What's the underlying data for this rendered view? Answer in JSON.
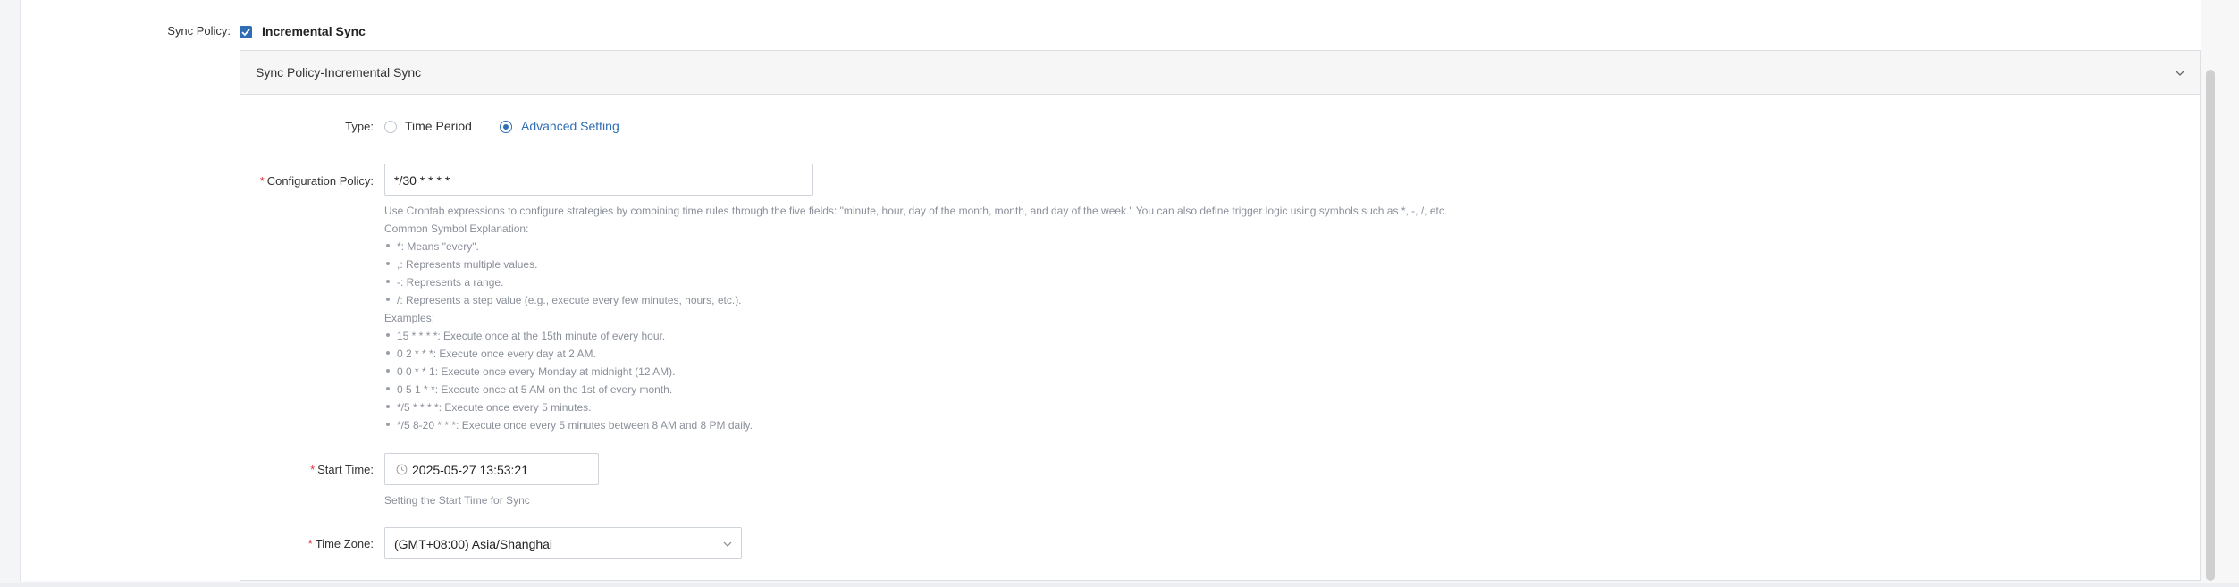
{
  "sync_policy": {
    "label": "Sync Policy:",
    "checkbox_label": "Incremental Sync",
    "checked": true
  },
  "panel": {
    "title": "Sync Policy-Incremental Sync"
  },
  "type_field": {
    "label": "Type:",
    "options": [
      "Time Period",
      "Advanced Setting"
    ],
    "selected": "Advanced Setting"
  },
  "config_policy": {
    "label": "Configuration Policy:",
    "value": "*/30 * * * *",
    "help_intro": "Use Crontab expressions to configure strategies by combining time rules through the five fields: \"minute, hour, day of the month, month, and day of the week.\" You can also define trigger logic using symbols such as *, -, /, etc.",
    "symbols_title": "Common Symbol Explanation:",
    "symbols": [
      "*: Means \"every\".",
      ",: Represents multiple values.",
      "-: Represents a range.",
      "/: Represents a step value (e.g., execute every few minutes, hours, etc.)."
    ],
    "examples_title": "Examples:",
    "examples": [
      "15 * * * *: Execute once at the 15th minute of every hour.",
      "0 2 * * *: Execute once every day at 2 AM.",
      "0 0 * * 1: Execute once every Monday at midnight (12 AM).",
      "0 5 1 * *: Execute once at 5 AM on the 1st of every month.",
      "*/5 * * * *: Execute once every 5 minutes.",
      "*/5 8-20 * * *: Execute once every 5 minutes between 8 AM and 8 PM daily."
    ]
  },
  "start_time": {
    "label": "Start Time:",
    "value": "2025-05-27 13:53:21",
    "help": "Setting the Start Time for Sync"
  },
  "time_zone": {
    "label": "Time Zone:",
    "value": "(GMT+08:00) Asia/Shanghai"
  }
}
